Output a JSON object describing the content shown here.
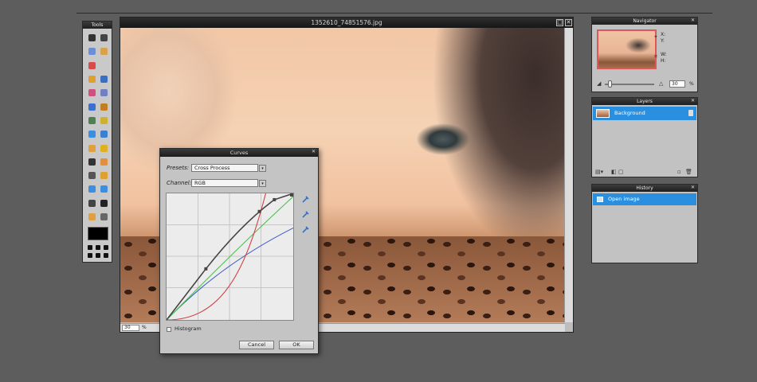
{
  "tools_panel": {
    "title": "Tools",
    "tools": [
      {
        "icon": "crop-icon",
        "color": "#333333"
      },
      {
        "icon": "move-icon",
        "color": "#444444"
      },
      {
        "icon": "marquee-icon",
        "color": "#6a8fd8"
      },
      {
        "icon": "lasso-icon",
        "color": "#d9a24a"
      },
      {
        "icon": "wand-icon",
        "color": "#d94a4a"
      },
      {
        "icon": "blank-icon",
        "color": "#c9c9c9"
      },
      {
        "icon": "pencil-icon",
        "color": "#e0a030"
      },
      {
        "icon": "brush-icon",
        "color": "#3a6fc0"
      },
      {
        "icon": "eraser-icon",
        "color": "#d05080"
      },
      {
        "icon": "replace-icon",
        "color": "#7080c0"
      },
      {
        "icon": "gradient-icon",
        "color": "#3c70d0"
      },
      {
        "icon": "fill-icon",
        "color": "#c08020"
      },
      {
        "icon": "clone-icon",
        "color": "#508050"
      },
      {
        "icon": "colorreplace-icon",
        "color": "#d0b030"
      },
      {
        "icon": "blur-icon",
        "color": "#3a8fe0"
      },
      {
        "icon": "sharpen-icon",
        "color": "#3a7fd0"
      },
      {
        "icon": "smudge-icon",
        "color": "#e0a040"
      },
      {
        "icon": "sponge-icon",
        "color": "#e0b020"
      },
      {
        "icon": "dodge-icon",
        "color": "#333333"
      },
      {
        "icon": "burn-icon",
        "color": "#e09040"
      },
      {
        "icon": "redeye-icon",
        "color": "#555555"
      },
      {
        "icon": "spot-heal-icon",
        "color": "#e0a030"
      },
      {
        "icon": "bloat-icon",
        "color": "#3a8fe0"
      },
      {
        "icon": "pinch-icon",
        "color": "#3a8fe0"
      },
      {
        "icon": "picker-icon",
        "color": "#444444"
      },
      {
        "icon": "type-icon",
        "color": "#222222"
      },
      {
        "icon": "hand-icon",
        "color": "#e0a040"
      },
      {
        "icon": "zoom-icon",
        "color": "#666666"
      }
    ],
    "active_color": "#000000"
  },
  "image_window": {
    "title": "1352610_74851576.jpg",
    "zoom_value": "30",
    "zoom_unit": "%"
  },
  "navigator": {
    "title": "Navigator",
    "x_label": "X:",
    "y_label": "Y:",
    "w_label": "W:",
    "h_label": "H:",
    "zoom_value": "30",
    "zoom_unit": "%"
  },
  "layers": {
    "title": "Layers",
    "items": [
      {
        "name": "Background"
      }
    ]
  },
  "history": {
    "title": "History",
    "items": [
      {
        "label": "Open image"
      }
    ]
  },
  "curves_dialog": {
    "title": "Curves",
    "presets_label": "Presets:",
    "presets_value": "Cross Process",
    "channel_label": "Channel:",
    "channel_value": "RGB",
    "histogram_label": "Histogram",
    "cancel_label": "Cancel",
    "ok_label": "OK",
    "curve_colors": {
      "rgb": "#444444",
      "red": "#d04040",
      "green": "#50c050",
      "blue": "#4060c8"
    }
  }
}
